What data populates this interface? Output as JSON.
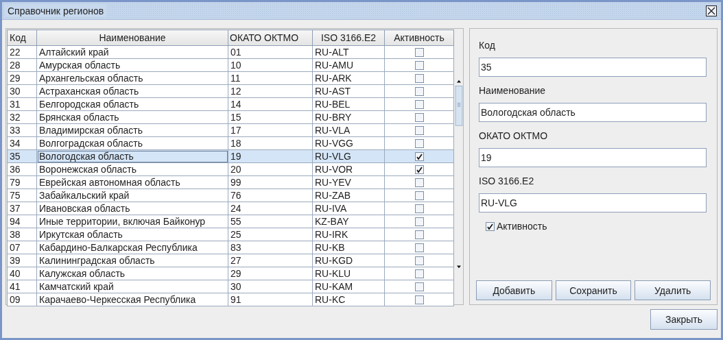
{
  "window": {
    "title": "Справочник регионов"
  },
  "table": {
    "columns": [
      "Код",
      "Наименование",
      "ОКАТО ОКТМО",
      "ISO 3166.E2",
      "Активность"
    ],
    "rows": [
      {
        "code": "22",
        "name": "Алтайский край",
        "okato": "01",
        "iso": "RU-ALT",
        "active": false,
        "selected": false
      },
      {
        "code": "28",
        "name": "Амурская область",
        "okato": "10",
        "iso": "RU-AMU",
        "active": false,
        "selected": false
      },
      {
        "code": "29",
        "name": "Архангельская область",
        "okato": "11",
        "iso": "RU-ARK",
        "active": false,
        "selected": false
      },
      {
        "code": "30",
        "name": "Астраханская область",
        "okato": "12",
        "iso": "RU-AST",
        "active": false,
        "selected": false
      },
      {
        "code": "31",
        "name": "Белгородская область",
        "okato": "14",
        "iso": "RU-BEL",
        "active": false,
        "selected": false
      },
      {
        "code": "32",
        "name": "Брянская область",
        "okato": "15",
        "iso": "RU-BRY",
        "active": false,
        "selected": false
      },
      {
        "code": "33",
        "name": "Владимирская область",
        "okato": "17",
        "iso": "RU-VLA",
        "active": false,
        "selected": false
      },
      {
        "code": "34",
        "name": "Волгоградская область",
        "okato": "18",
        "iso": "RU-VGG",
        "active": false,
        "selected": false
      },
      {
        "code": "35",
        "name": "Вологодская область",
        "okato": "19",
        "iso": "RU-VLG",
        "active": true,
        "selected": true
      },
      {
        "code": "36",
        "name": "Воронежская область",
        "okato": "20",
        "iso": "RU-VOR",
        "active": true,
        "selected": false
      },
      {
        "code": "79",
        "name": "Еврейская автономная область",
        "okato": "99",
        "iso": "RU-YEV",
        "active": false,
        "selected": false
      },
      {
        "code": "75",
        "name": "Забайкальский край",
        "okato": "76",
        "iso": "RU-ZAB",
        "active": false,
        "selected": false
      },
      {
        "code": "37",
        "name": "Ивановская область",
        "okato": "24",
        "iso": "RU-IVA",
        "active": false,
        "selected": false
      },
      {
        "code": "94",
        "name": "Иные территории, включая Байконур",
        "okato": "55",
        "iso": "KZ-BAY",
        "active": false,
        "selected": false
      },
      {
        "code": "38",
        "name": "Иркутская область",
        "okato": "25",
        "iso": "RU-IRK",
        "active": false,
        "selected": false
      },
      {
        "code": "07",
        "name": "Кабардино-Балкарская Республика",
        "okato": "83",
        "iso": "RU-KB",
        "active": false,
        "selected": false
      },
      {
        "code": "39",
        "name": "Калининградская область",
        "okato": "27",
        "iso": "RU-KGD",
        "active": false,
        "selected": false
      },
      {
        "code": "40",
        "name": "Калужская область",
        "okato": "29",
        "iso": "RU-KLU",
        "active": false,
        "selected": false
      },
      {
        "code": "41",
        "name": "Камчатский край",
        "okato": "30",
        "iso": "RU-KAM",
        "active": false,
        "selected": false
      },
      {
        "code": "09",
        "name": "Карачаево-Черкесская Республика",
        "okato": "91",
        "iso": "RU-KC",
        "active": false,
        "selected": false
      }
    ]
  },
  "form": {
    "fields": [
      {
        "label": "Код",
        "value": "35"
      },
      {
        "label": "Наименование",
        "value": "Вологодская область"
      },
      {
        "label": "ОКАТО ОКТМО",
        "value": "19"
      },
      {
        "label": "ISO 3166.E2",
        "value": "RU-VLG"
      }
    ],
    "checkbox": {
      "label": "Активность",
      "checked": true
    },
    "buttons": [
      "Добавить",
      "Сохранить",
      "Удалить"
    ]
  },
  "footer_buttons": [
    "Закрыть"
  ]
}
